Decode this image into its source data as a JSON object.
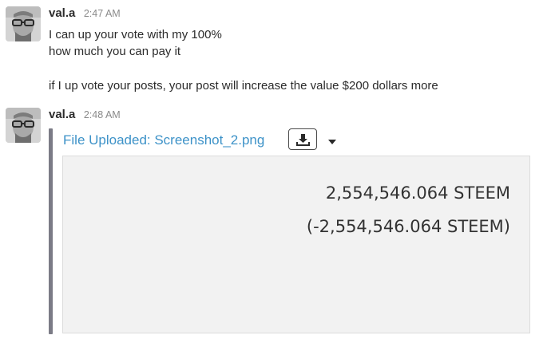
{
  "messages": [
    {
      "user": "val.a",
      "time": "2:47 AM",
      "lines": [
        "I can up your vote with my 100%",
        "how much you can pay it",
        "if I up vote your posts, your post will increase the value $200 dollars more"
      ]
    },
    {
      "user": "val.a",
      "time": "2:48 AM",
      "attachment": {
        "title": "File Uploaded: Screenshot_2.png",
        "download_icon": "download-icon",
        "menu_icon": "caret-down-icon",
        "preview_lines": [
          "2,554,546.064 STEEM",
          "(-2,554,546.064 STEEM)"
        ]
      }
    }
  ],
  "colors": {
    "link": "#3d92c8",
    "attachment_bar": "#7b7b86",
    "preview_bg": "#f2f2f2",
    "timestamp": "#8a8a8a"
  }
}
